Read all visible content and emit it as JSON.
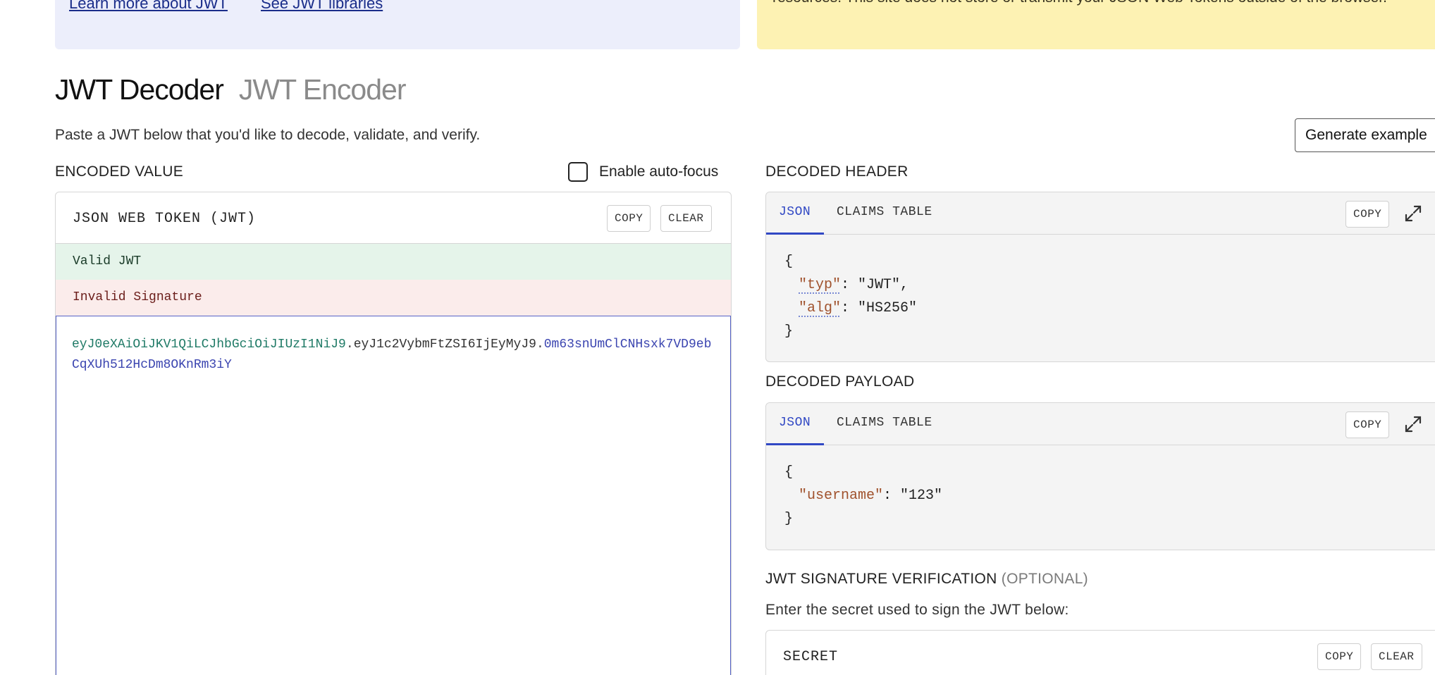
{
  "banner": {
    "learn_link": "Learn more about JWT",
    "libraries_link": "See JWT libraries",
    "notice": "resources. This site does not store or transmit your JSON Web Tokens outside of the browser."
  },
  "header": {
    "decoder_tab": "JWT Decoder",
    "encoder_tab": "JWT Encoder",
    "subtitle": "Paste a JWT below that you'd like to decode, validate, and verify.",
    "generate_button": "Generate example"
  },
  "encoded": {
    "section_label": "ENCODED VALUE",
    "autofocus_label": "Enable auto-focus",
    "autofocus_checked": false,
    "panel_title": "JSON WEB TOKEN (JWT)",
    "copy_label": "COPY",
    "clear_label": "CLEAR",
    "valid_status": "Valid JWT",
    "invalid_status": "Invalid Signature",
    "token_header": "eyJ0eXAiOiJKV1QiLCJhbGciOiJIUzI1NiJ9",
    "token_payload": "eyJ1c2VybmFtZSI6IjEyMyJ9",
    "token_signature": "0m63snUmClCNHsxk7VD9ebCqXUh512HcDm8OKnRm3iY",
    "dot": "."
  },
  "decoded_header": {
    "section_label": "DECODED HEADER",
    "tab_json": "JSON",
    "tab_claims": "CLAIMS TABLE",
    "copy_label": "COPY",
    "open_brace": "{",
    "close_brace": "}",
    "typ_key": "\"typ\"",
    "typ_value": "\"JWT\"",
    "alg_key": "\"alg\"",
    "alg_value": "\"HS256\""
  },
  "decoded_payload": {
    "section_label": "DECODED PAYLOAD",
    "tab_json": "JSON",
    "tab_claims": "CLAIMS TABLE",
    "copy_label": "COPY",
    "open_brace": "{",
    "close_brace": "}",
    "username_key": "\"username\"",
    "username_value": "\"123\""
  },
  "signature": {
    "section_label": "JWT SIGNATURE VERIFICATION",
    "optional": "(OPTIONAL)",
    "instructions": "Enter the secret used to sign the JWT below:",
    "secret_title": "SECRET",
    "copy_label": "COPY",
    "clear_label": "CLEAR"
  },
  "colors": {
    "accent": "#3148c4",
    "valid_bg": "#e5f4ea",
    "invalid_bg": "#fbeceb",
    "notice_bg": "#fdf2b3",
    "info_bg": "#eceefb"
  }
}
